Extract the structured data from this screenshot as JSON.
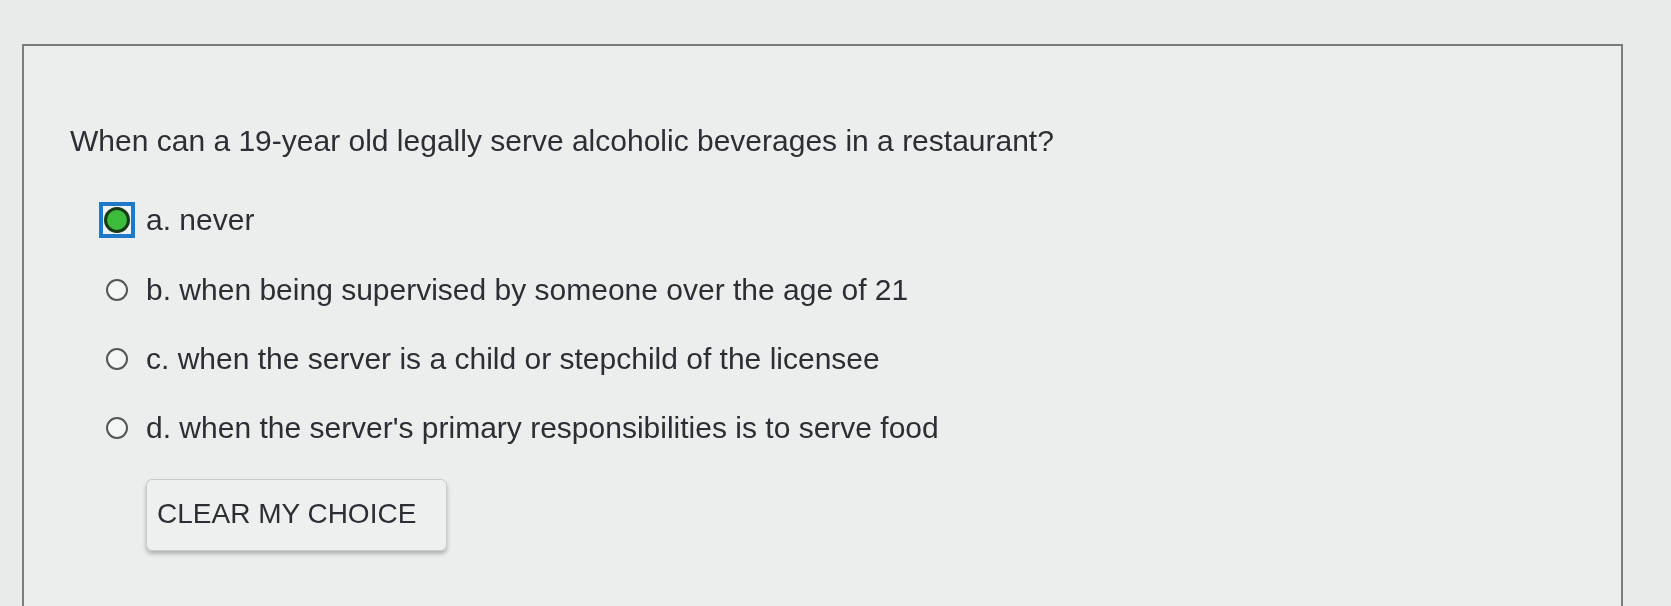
{
  "question": "When can a 19-year old legally serve alcoholic beverages in a restaurant?",
  "options": [
    {
      "label": "a. never",
      "selected": true
    },
    {
      "label": "b. when being supervised by someone over the age of 21",
      "selected": false
    },
    {
      "label": "c. when the server is a child or stepchild of the licensee",
      "selected": false
    },
    {
      "label": "d. when the server's primary responsibilities is to serve food",
      "selected": false
    }
  ],
  "clear_button": "CLEAR MY CHOICE"
}
